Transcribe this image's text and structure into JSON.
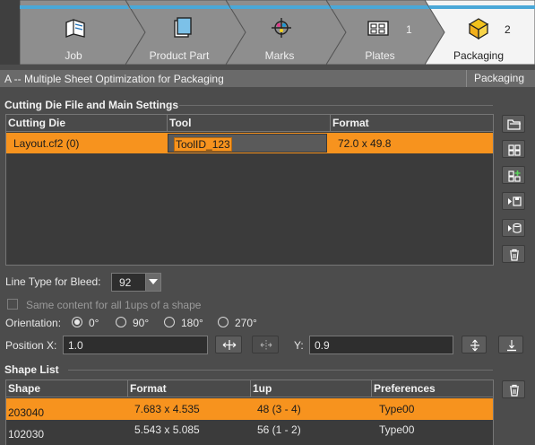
{
  "tabs": [
    {
      "label": "Job",
      "icon": "job-folder-icon",
      "badge": ""
    },
    {
      "label": "Product Part",
      "icon": "product-part-icon",
      "badge": ""
    },
    {
      "label": "Marks",
      "icon": "marks-crosshair-icon",
      "badge": ""
    },
    {
      "label": "Plates",
      "icon": "plates-icon",
      "badge": "1"
    },
    {
      "label": "Packaging",
      "icon": "packaging-icon",
      "badge": "2",
      "active": true
    }
  ],
  "titlebar": {
    "title": "A -- Multiple Sheet Optimization for Packaging",
    "context": "Packaging"
  },
  "cutting_die": {
    "section_title": "Cutting Die File and Main Settings",
    "columns": [
      "Cutting Die",
      "Tool",
      "Format"
    ],
    "rows": [
      {
        "cutting_die": "Layout.cf2 (0)",
        "tool": "ToolID_123",
        "format": "72.0 x 49.8",
        "selected": true
      }
    ]
  },
  "side_buttons": [
    "open-file-icon",
    "shape-link-icon",
    "shape-add-icon",
    "export-die-icon",
    "import-die-icon",
    "delete-icon"
  ],
  "bleed": {
    "label": "Line Type for Bleed:",
    "value": "92"
  },
  "same_content": {
    "label": "Same content for all 1ups of a shape",
    "checked": false,
    "disabled": true
  },
  "orientation": {
    "label": "Orientation:",
    "options": [
      "0°",
      "90°",
      "180°",
      "270°"
    ],
    "selected": "0°"
  },
  "position": {
    "x_label": "Position X:",
    "x_value": "1.0",
    "y_label": "Y:",
    "y_value": "0.9"
  },
  "shape_list": {
    "section_title": "Shape List",
    "columns": [
      "Shape",
      "Format",
      "1up",
      "Preferences"
    ],
    "rows": [
      {
        "shape": "203040",
        "format": "7.683 x 4.535",
        "oneup": "48 (3 - 4)",
        "preferences": "Type00",
        "selected": true
      },
      {
        "shape": "102030",
        "format": "5.543 x 5.085",
        "oneup": "56 (1 - 2)",
        "preferences": "Type00",
        "selected": false
      }
    ]
  },
  "colors": {
    "accent": "#f7931e",
    "tab_stripe": "#4aa8d8",
    "background": "#4c4c4c"
  }
}
